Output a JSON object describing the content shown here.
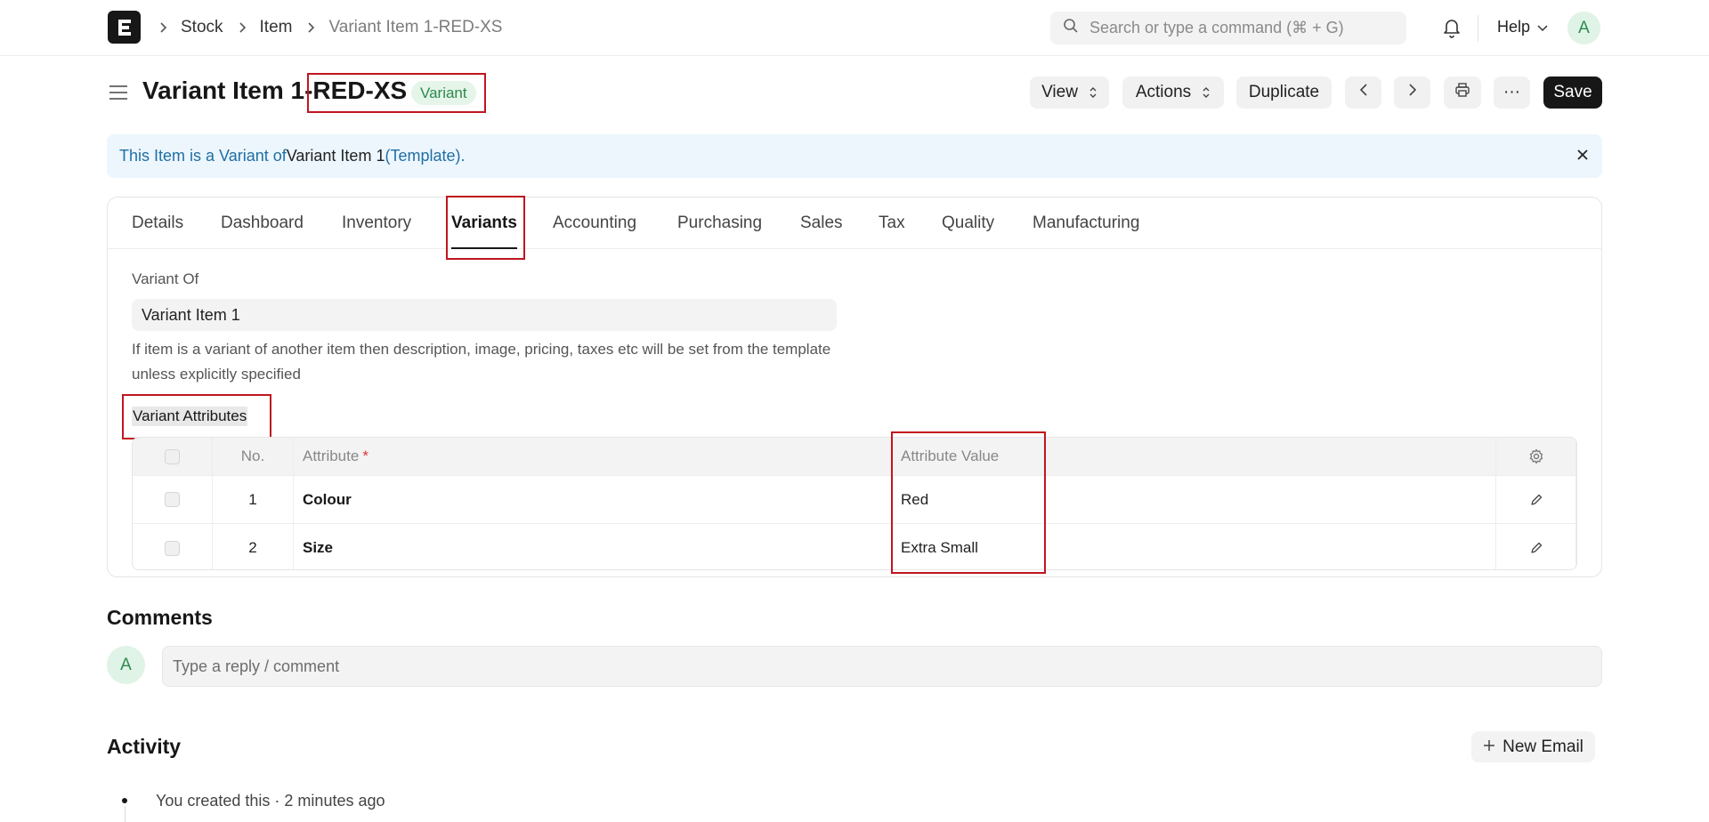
{
  "navbar": {
    "logo_letter": "E",
    "breadcrumbs": [
      "Stock",
      "Item",
      "Variant Item 1-RED-XS"
    ],
    "search_placeholder": "Search or type a command (⌘ + G)",
    "help_label": "Help",
    "user_initial": "A"
  },
  "page": {
    "title": "Variant Item 1-RED-XS",
    "status_badge": "Variant",
    "buttons": {
      "view": "View",
      "actions": "Actions",
      "duplicate": "Duplicate",
      "more": "···",
      "save": "Save"
    }
  },
  "banner": {
    "text_1": "This Item is a Variant of ",
    "template_name": "Variant Item 1",
    "text_2": " (Template)."
  },
  "tabs": [
    {
      "label": "Details"
    },
    {
      "label": "Dashboard"
    },
    {
      "label": "Inventory"
    },
    {
      "label": "Variants",
      "active": true
    },
    {
      "label": "Accounting"
    },
    {
      "label": "Purchasing"
    },
    {
      "label": "Sales"
    },
    {
      "label": "Tax"
    },
    {
      "label": "Quality"
    },
    {
      "label": "Manufacturing"
    }
  ],
  "variant_of": {
    "label": "Variant Of",
    "value": "Variant Item 1",
    "help": "If item is a variant of another item then description, image, pricing, taxes etc will be set from the template unless explicitly specified"
  },
  "variant_attributes": {
    "section_title": "Variant Attributes",
    "columns": {
      "no": "No.",
      "attribute": "Attribute",
      "required_mark": "*",
      "attribute_value": "Attribute Value"
    },
    "rows": [
      {
        "no": "1",
        "attribute": "Colour",
        "value": "Red"
      },
      {
        "no": "2",
        "attribute": "Size",
        "value": "Extra Small"
      }
    ]
  },
  "comments": {
    "title": "Comments",
    "user_initial": "A",
    "placeholder": "Type a reply / comment"
  },
  "activity": {
    "title": "Activity",
    "new_email_label": "New Email",
    "items": [
      "You created this · 2 minutes ago"
    ]
  },
  "colors": {
    "highlight": "#c0161f",
    "primary": "#171717",
    "banner_bg": "#edf6fd",
    "banner_text": "#1f6fa5",
    "badge_bg": "#e5f5ea",
    "badge_text": "#2b8a4b"
  },
  "icons": [
    "app-logo",
    "chevron-right-icon",
    "search-icon",
    "bell-icon",
    "chevron-down-icon",
    "menu-icon",
    "sort-icon",
    "chevron-left-icon",
    "printer-icon",
    "close-icon",
    "gear-icon",
    "pencil-icon",
    "plus-icon"
  ]
}
